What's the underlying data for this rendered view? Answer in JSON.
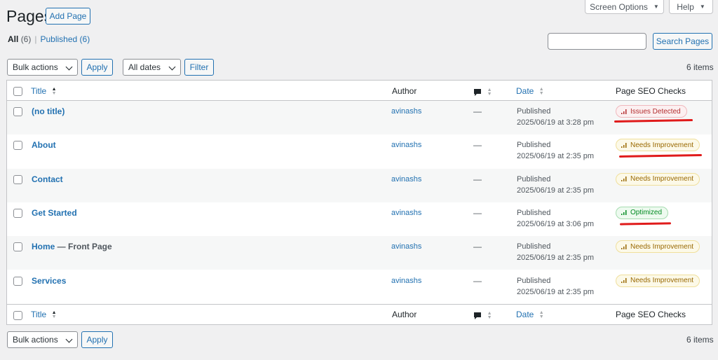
{
  "header": {
    "title": "Pages",
    "add_button": "Add Page",
    "screen_options": "Screen Options",
    "help": "Help"
  },
  "filters": {
    "all_label": "All",
    "all_count": "(6)",
    "separator": "|",
    "published_label": "Published",
    "published_count": "(6)"
  },
  "search": {
    "value": "",
    "button": "Search Pages"
  },
  "toolbar_top": {
    "bulk_actions": "Bulk actions",
    "apply": "Apply",
    "dates": "All dates",
    "filter": "Filter",
    "items_count": "6 items"
  },
  "toolbar_bottom": {
    "bulk_actions": "Bulk actions",
    "apply": "Apply",
    "items_count": "6 items"
  },
  "columns": {
    "title": "Title",
    "author": "Author",
    "date": "Date",
    "seo": "Page SEO Checks"
  },
  "rows": [
    {
      "title": "(no title)",
      "suffix": "",
      "author": "avinashs",
      "comments": "—",
      "status": "Published",
      "date": "2025/06/19 at 3:28 pm",
      "seo": "Issues Detected",
      "seo_kind": "issues"
    },
    {
      "title": "About",
      "suffix": "",
      "author": "avinashs",
      "comments": "—",
      "status": "Published",
      "date": "2025/06/19 at 2:35 pm",
      "seo": "Needs Improvement",
      "seo_kind": "improve"
    },
    {
      "title": "Contact",
      "suffix": "",
      "author": "avinashs",
      "comments": "—",
      "status": "Published",
      "date": "2025/06/19 at 2:35 pm",
      "seo": "Needs Improvement",
      "seo_kind": "improve"
    },
    {
      "title": "Get Started",
      "suffix": "",
      "author": "avinashs",
      "comments": "—",
      "status": "Published",
      "date": "2025/06/19 at 3:06 pm",
      "seo": "Optimized",
      "seo_kind": "optimized"
    },
    {
      "title": "Home",
      "suffix": " — Front Page",
      "author": "avinashs",
      "comments": "—",
      "status": "Published",
      "date": "2025/06/19 at 2:35 pm",
      "seo": "Needs Improvement",
      "seo_kind": "improve"
    },
    {
      "title": "Services",
      "suffix": "",
      "author": "avinashs",
      "comments": "—",
      "status": "Published",
      "date": "2025/06/19 at 2:35 pm",
      "seo": "Needs Improvement",
      "seo_kind": "improve"
    }
  ],
  "colors": {
    "accent": "#2271b1",
    "issues": "#b32d2e",
    "improve": "#996800",
    "optimized": "#008a20",
    "annotation": "#e01b1b"
  },
  "icons": [
    "comment-bubble-icon",
    "sort-arrows-icon",
    "chevron-down-icon",
    "signal-bars-icon"
  ]
}
